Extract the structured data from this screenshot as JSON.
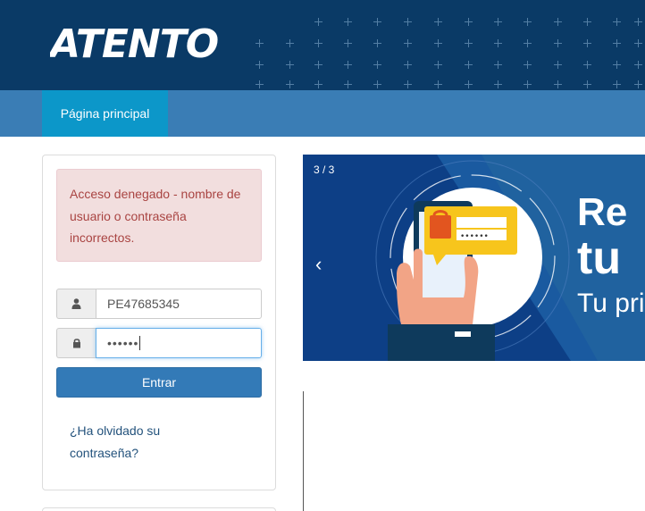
{
  "header": {
    "logo_text": "ATENTO",
    "bg_color": "#0a3a66"
  },
  "nav": {
    "items": [
      {
        "label": "Página principal",
        "active": true
      }
    ]
  },
  "login": {
    "alert_message": "Acceso denegado - nombre de usuario o contraseña incorrectos.",
    "username": {
      "value": "PE47685345",
      "icon": "user-icon"
    },
    "password": {
      "value": "••••••",
      "icon": "lock-icon"
    },
    "submit_label": "Entrar",
    "forgot_link": "¿Ha olvidado su contraseña?"
  },
  "carousel": {
    "counter": "3 / 3",
    "prev_label": "‹",
    "slide": {
      "line1": "Re",
      "line2": "tu",
      "line3": "Tu pri",
      "phone_password_mask": "••••••"
    }
  },
  "colors": {
    "primary_button": "#337ab7",
    "nav_bar": "#3a7db5",
    "nav_active": "#0c97c9",
    "alert_bg": "#f2dede",
    "alert_text": "#a94442",
    "link": "#23527c"
  }
}
